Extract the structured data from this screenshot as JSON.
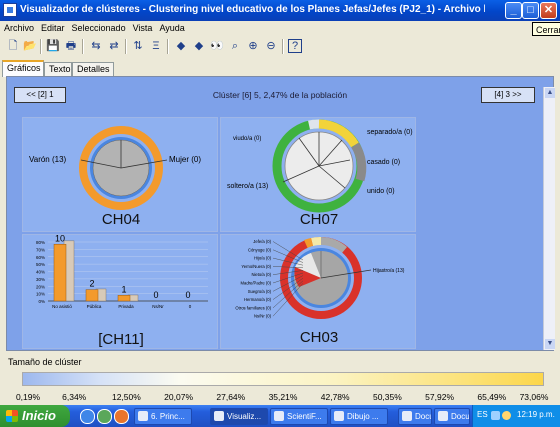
{
  "window": {
    "title": "Visualizador de clústeres - Clustering nivel educativo de los Planes Jefas/Jefes (PJ2_1) - Archivo local: general l...",
    "close_tooltip": "Cerrar",
    "min_glyph": "_",
    "max_glyph": "□",
    "close_glyph": "✕"
  },
  "menu": [
    "Archivo",
    "Editar",
    "Seleccionado",
    "Vista",
    "Ayuda"
  ],
  "toolbar": {
    "icons": [
      "new-icon",
      "open-icon",
      "save-icon",
      "print-icon",
      "reload-icon",
      "forward-icon",
      "sort-icon",
      "filter-icon",
      "arrow-left-icon",
      "arrow-right-icon",
      "binoculars-icon",
      "search-icon",
      "zoom-in-icon",
      "zoom-out-icon",
      "help-icon"
    ],
    "glyphs": [
      "🗋",
      "📂",
      "💾",
      "🖶",
      "⇆",
      "⇄",
      "⇅",
      "Ξ",
      "◆",
      "◆",
      "👀",
      "⌕",
      "⊕",
      "⊖",
      "?"
    ]
  },
  "tabs": [
    "Gráficos",
    "Texto",
    "Detalles"
  ],
  "nav": {
    "prev": "<< [2] 1",
    "next": "[4] 3 >>"
  },
  "cluster_title": "Clúster [6] 5, 2,47% de la población",
  "panels": {
    "ch04": {
      "label": "CH04",
      "slices": [
        {
          "name": "Varón (13)",
          "count": 13
        },
        {
          "name": "Mujer (0)",
          "count": 0
        }
      ]
    },
    "ch07": {
      "label": "CH07",
      "slices": [
        {
          "name": "viudo/a (0)",
          "count": 0
        },
        {
          "name": "separado/a (0)",
          "count": 0
        },
        {
          "name": "casado (0)",
          "count": 0
        },
        {
          "name": "unido (0)",
          "count": 0
        },
        {
          "name": "soltero/a (13)",
          "count": 13
        }
      ]
    },
    "ch11": {
      "label": "[CH11]",
      "yticks": [
        "80%",
        "70%",
        "60%",
        "50%",
        "40%",
        "30%",
        "20%",
        "10%",
        "0%"
      ],
      "categories": [
        "No asistió",
        "Pública",
        "Privada",
        "Ns/Nr",
        "0"
      ],
      "values": [
        10,
        2,
        1,
        0,
        0
      ]
    },
    "ch03": {
      "label": "CH03",
      "legend": [
        "Jefe/a (0)",
        "Cónyuge (0)",
        "Hijo/a (0)",
        "Yerno/Nuera (0)",
        "Nieto/a (0)",
        "Madre/Padre (0)",
        "Suegro/a (0)",
        "Hermano/a (0)",
        "Otros familiares (0)",
        "Ns/Nr (0)",
        "Hijastro/a (13)"
      ]
    }
  },
  "cluster_size": {
    "title": "Tamaño de clúster",
    "ticks": [
      "0,19%",
      "6,34%",
      "12,50%",
      "20,07%",
      "27,64%",
      "35,21%",
      "42,78%",
      "50,35%",
      "57,92%",
      "65,49%",
      "73,06%"
    ]
  },
  "taskbar": {
    "start": "Inicio",
    "tasks": [
      "6. Princ...",
      "Visualiz...",
      "ScientiF...",
      "Dibujo ...",
      "Docum...",
      "Docum..."
    ],
    "lang": "ES",
    "clock": "12:19 p.m."
  },
  "colors": {
    "accent": "#0a5fe6",
    "panel": "#8eb0f0",
    "orange": "#f39a2c",
    "green": "#3fb23f",
    "yellow": "#f2d33a",
    "red": "#d9322a",
    "gray": "#a6a6a6"
  }
}
